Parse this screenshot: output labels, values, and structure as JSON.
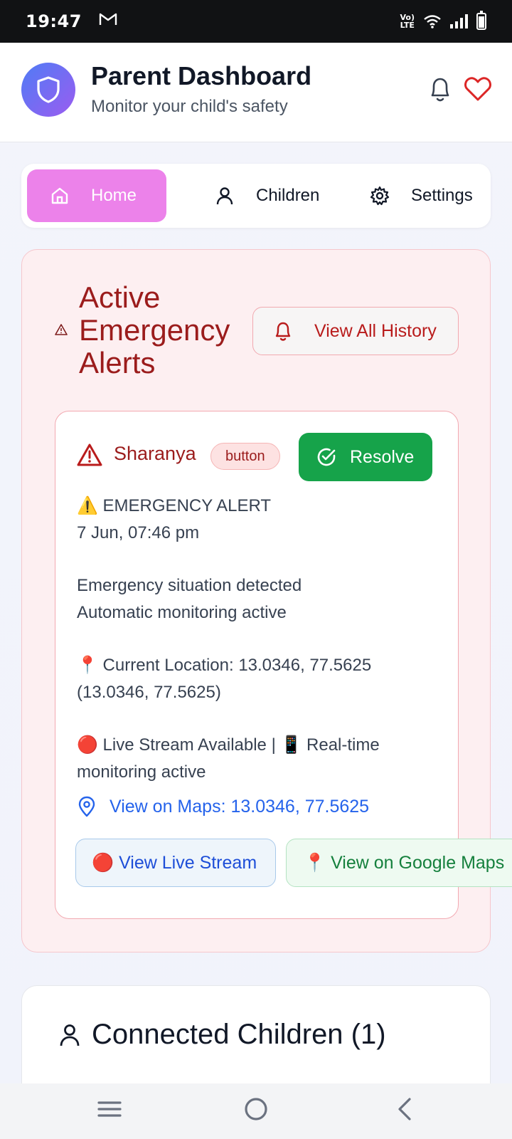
{
  "status_bar": {
    "time": "19:47",
    "mail_icon": "gmail-icon",
    "volte": "Vo) LTE"
  },
  "header": {
    "title": "Parent Dashboard",
    "subtitle": "Monitor your child's safety",
    "logo_icon": "shield-icon",
    "accent_colors": [
      "#4f7cf5",
      "#9b5cf0"
    ]
  },
  "tabs": [
    {
      "label": "Home",
      "icon": "home-icon",
      "active": true
    },
    {
      "label": "Children",
      "icon": "user-icon",
      "active": false
    },
    {
      "label": "Settings",
      "icon": "gear-icon",
      "active": false
    }
  ],
  "alerts": {
    "title": "Active Emergency Alerts",
    "history_button": "View All History",
    "item": {
      "child_name": "Sharanya",
      "badge": "button",
      "resolve_button": "Resolve",
      "line1": "⚠️ EMERGENCY ALERT",
      "line2": "7 Jun, 07:46 pm",
      "line3": "Emergency situation detected",
      "line4": "Automatic monitoring active",
      "line5": "📍 Current Location: 13.0346, 77.5625 (13.0346, 77.5625)",
      "line6": "🔴 Live Stream Available | 📱 Real-time monitoring active",
      "maps_link": "View on Maps: 13.0346, 77.5625",
      "live_stream_button": "🔴 View Live Stream",
      "google_maps_button": "📍 View on Google Maps"
    }
  },
  "connected_children": {
    "title": "Connected Children (1)"
  },
  "colors": {
    "danger": "#9b1c1c",
    "success": "#16a34a",
    "link": "#2563eb",
    "tab_active": "#ec82ea"
  }
}
